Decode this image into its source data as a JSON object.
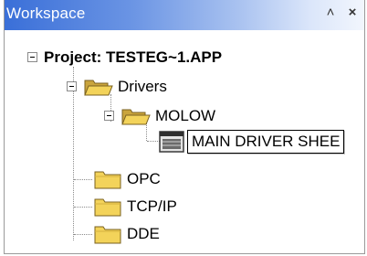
{
  "panel": {
    "title": "Workspace",
    "pin_glyph": "˄",
    "close_glyph": "×"
  },
  "tree": {
    "root": {
      "label": "Project: TESTEG~1.APP",
      "expanded": true
    },
    "drivers": {
      "label": "Drivers",
      "expanded": true,
      "icon": "folder-open-icon"
    },
    "molow": {
      "label": "MOLOW",
      "expanded": true,
      "icon": "folder-open-icon"
    },
    "sheet": {
      "label": "MAIN DRIVER SHEE",
      "icon": "driver-sheet-icon",
      "selected": true
    },
    "opc": {
      "label": "OPC",
      "icon": "folder-icon"
    },
    "tcpip": {
      "label": "TCP/IP",
      "icon": "folder-icon"
    },
    "dde": {
      "label": "DDE",
      "icon": "folder-icon"
    }
  },
  "colors": {
    "title_start": "#3a6fd8",
    "folder_yellow": "#f3d35a",
    "selection_border": "#000000"
  }
}
